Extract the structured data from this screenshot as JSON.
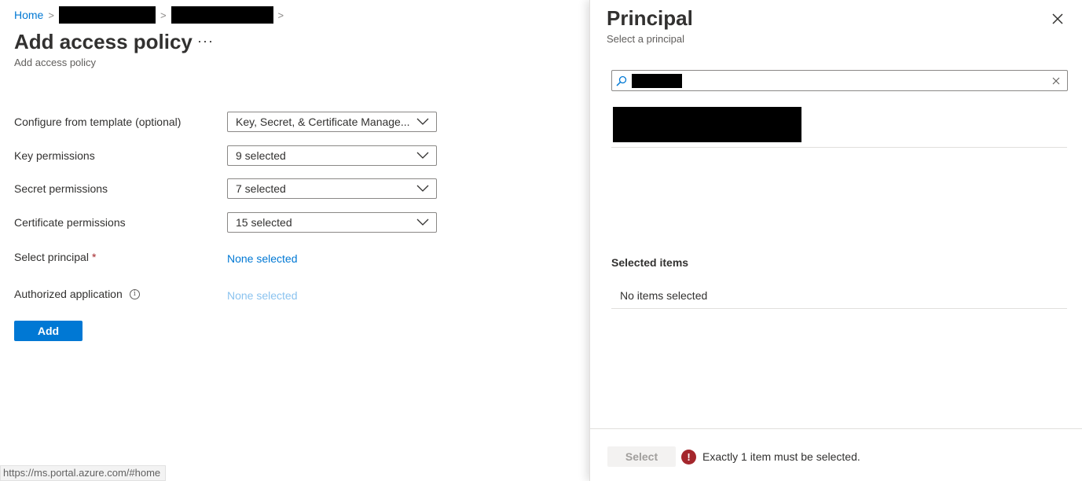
{
  "breadcrumb": {
    "home": "Home",
    "separator": ">"
  },
  "page": {
    "title": "Add access policy",
    "more": "···",
    "subtitle": "Add access policy"
  },
  "form": {
    "template": {
      "label": "Configure from template (optional)",
      "value": "Key, Secret, & Certificate Manage..."
    },
    "key": {
      "label": "Key permissions",
      "value": "9 selected"
    },
    "secret": {
      "label": "Secret permissions",
      "value": "7 selected"
    },
    "certificate": {
      "label": "Certificate permissions",
      "value": "15 selected"
    },
    "principal": {
      "label": "Select principal",
      "required_marker": "*",
      "value": "None selected"
    },
    "authorized_app": {
      "label": "Authorized application",
      "info": "i",
      "value": "None selected"
    },
    "add_label": "Add"
  },
  "status_bar": {
    "url": "https://ms.portal.azure.com/#home"
  },
  "panel": {
    "title": "Principal",
    "subtitle": "Select a principal",
    "selected_heading": "Selected items",
    "no_items": "No items selected",
    "select_label": "Select",
    "error_icon": "!",
    "error_text": "Exactly 1 item must be selected."
  },
  "colors": {
    "accent": "#0078d4",
    "error": "#a4262c",
    "disabled_link": "#8bc3ef"
  },
  "icons": {
    "chevron": "chevron-down-icon",
    "search": "search-icon",
    "close": "close-icon",
    "clear": "clear-icon",
    "info": "info-icon",
    "error": "error-icon"
  }
}
